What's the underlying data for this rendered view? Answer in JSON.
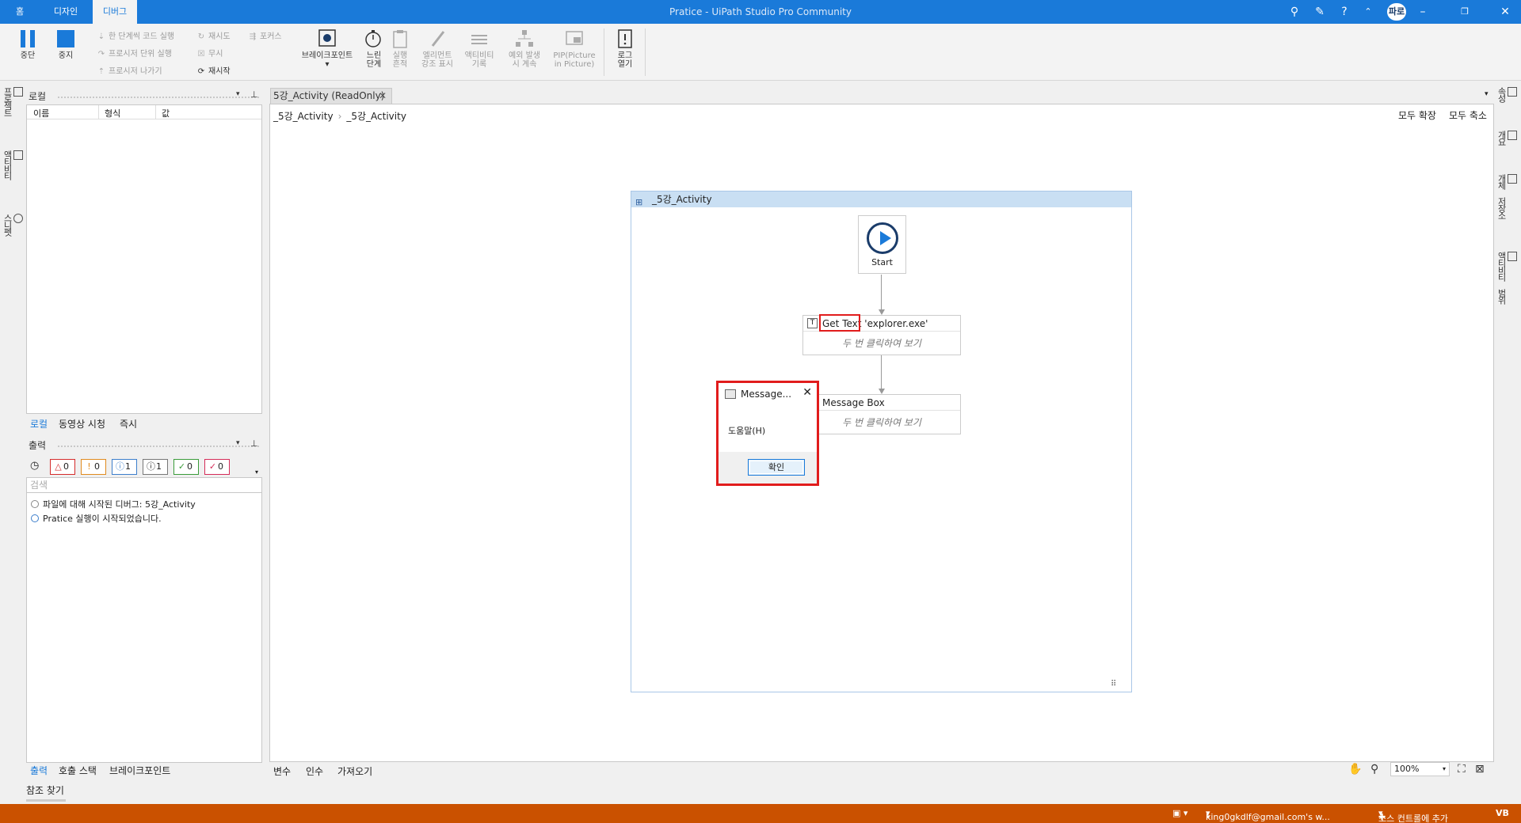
{
  "titlebar": {
    "title": "Pratice - UiPath Studio Pro Community",
    "tabs": [
      "홈",
      "디자인",
      "디버그"
    ],
    "avatar": "파로"
  },
  "ribbon": {
    "pause": "중단",
    "stop": "중지",
    "step_into": "한 단계씩 코드 실행",
    "step_over": "프로시저 단위 실행",
    "step_out": "프로시저 나가기",
    "retry": "재시도",
    "ignore": "무시",
    "restart": "재시작",
    "focus": "포커스",
    "breakpoints": "브레이크포인트",
    "slow_step": [
      "느린",
      "단계"
    ],
    "execution_trail": [
      "실행",
      "흔적"
    ],
    "highlight": [
      "엘리먼트",
      "강조 표시"
    ],
    "log_activities": [
      "액티비티",
      "기록"
    ],
    "continue_on_exception": [
      "예외 발생",
      "시 계속"
    ],
    "pip": [
      "PIP(Picture",
      "in Picture)"
    ],
    "open_logs": [
      "로그",
      "열기"
    ]
  },
  "left_strip": [
    "프로젝트",
    "액티비티",
    "스니펫"
  ],
  "locals_panel": {
    "title": "로컬",
    "columns": [
      "이름",
      "형식",
      "값"
    ],
    "tabs": [
      "로컬",
      "동영상 시청",
      "즉시"
    ]
  },
  "output_panel": {
    "title": "출력",
    "filters": [
      "0",
      "0",
      "1",
      "1",
      "0",
      "0"
    ],
    "search_placeholder": "검색",
    "logs": [
      "파일에 대해 시작된 디버그: 5강_Activity",
      "Pratice 실행이 시작되었습니다."
    ],
    "tabs": [
      "출력",
      "호출 스택",
      "브레이크포인트"
    ]
  },
  "document": {
    "tab_label": "5강_Activity (ReadOnly)",
    "breadcrumb": [
      "_5강_Activity",
      "_5강_Activity"
    ],
    "expand_all": "모두 확장",
    "collapse_all": "모두 축소",
    "flowchart_title": "_5강_Activity",
    "start_label": "Start",
    "activities": [
      {
        "title": "Get Text 'explorer.exe'",
        "body": "두 번 클릭하여 보기"
      },
      {
        "title": "Message Box",
        "body": "두 번 클릭하여 보기"
      }
    ],
    "bottom_tabs": [
      "변수",
      "인수",
      "가져오기"
    ],
    "zoom": "100%"
  },
  "message_box": {
    "title": "Message...",
    "text": "도움말(H)",
    "ok": "확인"
  },
  "right_strip": [
    "속성",
    "개요",
    "개체 저장소",
    "액티비티 범위"
  ],
  "reference_bar": "참조 찾기",
  "statusbar": {
    "account": "king0gkdlf@gmail.com's w...",
    "source_control": "소스 컨트롤에 추가",
    "vb": "VB"
  },
  "colors": {
    "titlebar": "#1a7ad9",
    "statusbar": "#ca5100",
    "highlight": "#e11c1c"
  }
}
